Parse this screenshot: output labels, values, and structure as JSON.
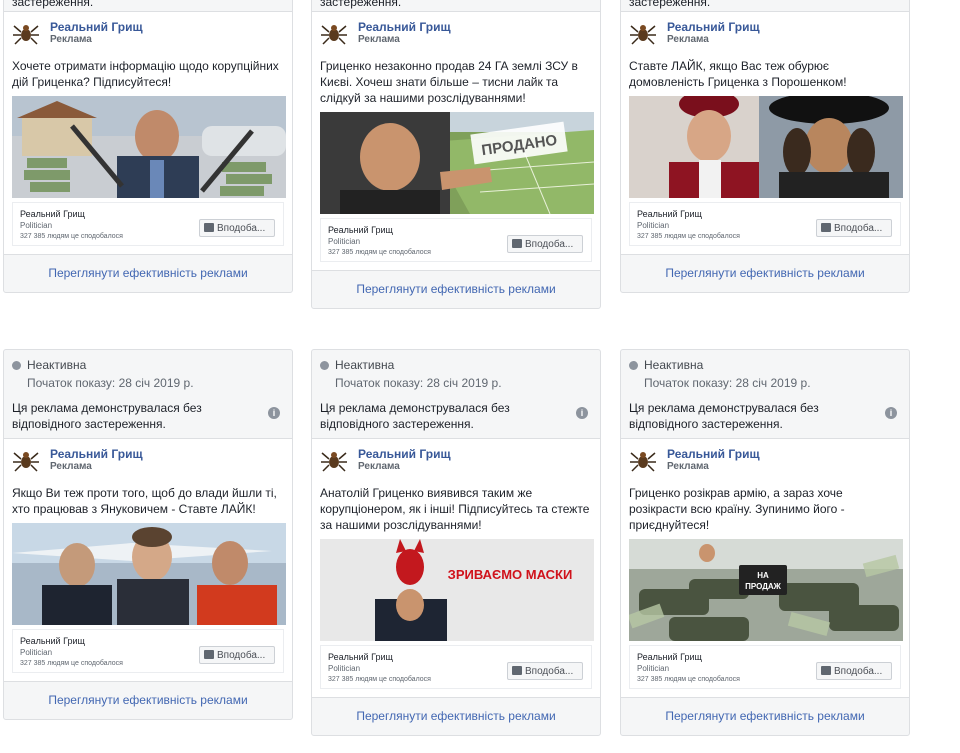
{
  "card_common": {
    "note_stub": "застереження.",
    "status": "Неактивна",
    "start_date": "Початок показу: 28 січ 2019 р.",
    "note": "Ця реклама демонструвалася без відповідного застереження.",
    "info_glyph": "i",
    "page_name": "Реальний Грищ",
    "sponsored": "Реклама",
    "footer_category": "Politician",
    "footer_likes": "327 385 людям це сподобалося",
    "like_button": "Вподоба...",
    "perf_link": "Переглянути ефективність реклами"
  },
  "cards": [
    {
      "text": "Хочете отримати інформацію щодо корупційних дій Гриценка? Підписуйтеся!",
      "image_icon": "money-villa-photo"
    },
    {
      "text": "Гриценко незаконно продав 24 ГА землі ЗСУ в Києві. Хочеш знати більше – тисни лайк та слідкуй за нашими розслідуваннями!",
      "image_overlay": "ПРОДАНО",
      "image_icon": "sold-land-photo"
    },
    {
      "text": "Ставте ЛАЙК, якщо Вас теж обурює домовленість Гриценка з Порошенком!",
      "image_icon": "clergy-photo"
    },
    {
      "text": "Якщо Ви теж проти того, щоб до влади йшли ті, хто працював з Януковичем - Ставте ЛАЙК!",
      "image_icon": "three-politicians-photo"
    },
    {
      "text": "Анатолій Гриценко виявився таким же корупціонером, як і інші! Підписуйтесь та стежте за нашими розслідуваннями!",
      "image_overlay": "ЗРИВАЄМО МАСКИ",
      "image_icon": "devil-mask-photo"
    },
    {
      "text": "Гриценко розікрав армію, а зараз хоче розікрасти всю країну. Зупинимо його - приєднуйтеся!",
      "image_overlay": "НА ПРОДАЖ",
      "image_icon": "tanks-for-sale-photo"
    }
  ],
  "colors": {
    "link": "#4267b2",
    "page_name": "#385898",
    "status_dot": "#8d949e"
  }
}
